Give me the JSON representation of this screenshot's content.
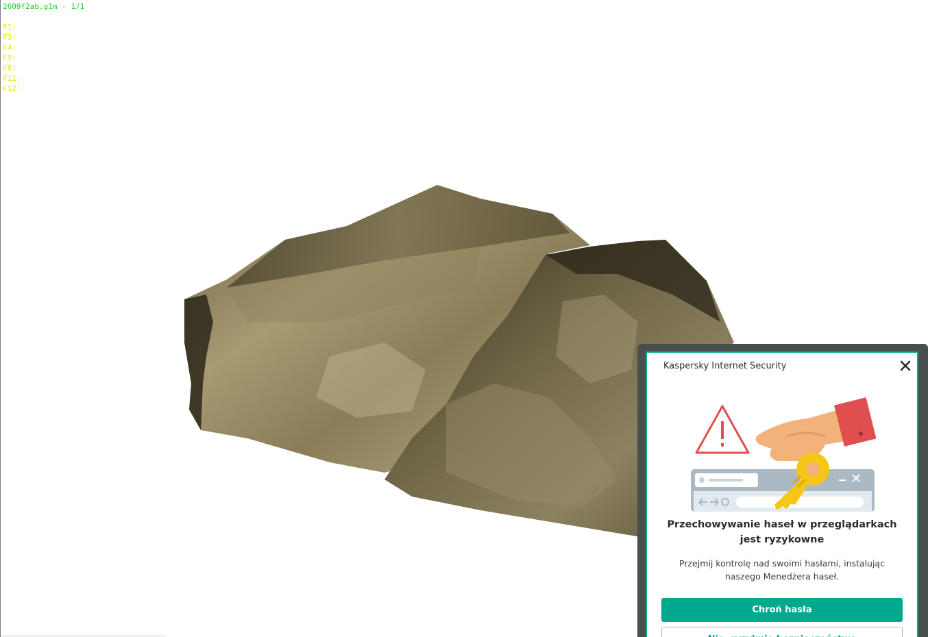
{
  "viewer": {
    "title": "2609f2ab.g1m - 1/1",
    "keys": [
      "F1:",
      "F3:",
      "F4:",
      "F5:",
      "F8:",
      "F11:",
      "F12:"
    ]
  },
  "popup": {
    "app_name": "Kaspersky Internet Security",
    "close_icon": "close-icon",
    "illustration_icon": "password-key-illustration",
    "title": "Przechowywanie haseł w przeglądarkach jest ryzykowne",
    "description": "Przejmij kontrolę nad swoimi hasłami, instalując naszego Menedżera haseł.",
    "primary_button": "Chroń hasła",
    "secondary_button": "Nie, ryzykuję bezpieczeństwo",
    "accent_color": "#00a88e",
    "warning_color": "#e04f4f",
    "key_color": "#f5c518"
  }
}
